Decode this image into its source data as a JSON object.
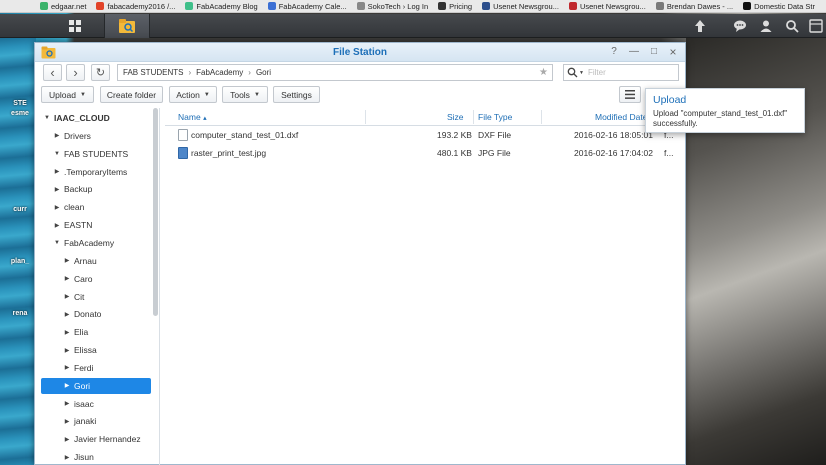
{
  "bookmarks": [
    {
      "label": "edgaar.net",
      "color": "#3bb36b"
    },
    {
      "label": "fabacademy2016 /...",
      "color": "#e24329"
    },
    {
      "label": "FabAcademy Blog",
      "color": "#3fbf8a"
    },
    {
      "label": "FabAcademy Cale...",
      "color": "#3b6fd4"
    },
    {
      "label": "SokoTech › Log In",
      "color": "#888888"
    },
    {
      "label": "Pricing",
      "color": "#333333"
    },
    {
      "label": "Usenet Newsgrou...",
      "color": "#2b4e8c"
    },
    {
      "label": "Usenet Newsgrou...",
      "color": "#c0282d"
    },
    {
      "label": "Brendan Dawes - ...",
      "color": "#7a7a7a"
    },
    {
      "label": "Domestic Data Str",
      "color": "#111111"
    }
  ],
  "desktop": {
    "labels": [
      "STE",
      "esme",
      "curr",
      "plan_",
      "rena"
    ]
  },
  "window": {
    "title": "File Station",
    "controls": {
      "help": "?",
      "minimize": "—",
      "maximize": "□",
      "close": "×"
    }
  },
  "nav": {
    "back": "‹",
    "forward": "›",
    "refresh": "↻",
    "path": [
      "FAB STUDENTS",
      "FabAcademy",
      "Gori"
    ],
    "path_sep": "›",
    "search_placeholder": "Filter"
  },
  "toolbar": {
    "upload": "Upload",
    "create_folder": "Create folder",
    "action": "Action",
    "tools": "Tools",
    "settings": "Settings"
  },
  "tree": [
    {
      "label": "IAAC_CLOUD",
      "level": 0,
      "expanded": true,
      "bold": true
    },
    {
      "label": "Drivers",
      "level": 1,
      "expanded": false
    },
    {
      "label": "FAB STUDENTS",
      "level": 1,
      "expanded": true
    },
    {
      "label": ".TemporaryItems",
      "level": 2,
      "expanded": false
    },
    {
      "label": "Backup",
      "level": 2,
      "expanded": false
    },
    {
      "label": "clean",
      "level": 2,
      "expanded": false
    },
    {
      "label": "EASTN",
      "level": 2,
      "expanded": false
    },
    {
      "label": "FabAcademy",
      "level": 2,
      "expanded": true
    },
    {
      "label": "Arnau",
      "level": 3,
      "expanded": false
    },
    {
      "label": "Caro",
      "level": 3,
      "expanded": false
    },
    {
      "label": "Cit",
      "level": 3,
      "expanded": false
    },
    {
      "label": "Donato",
      "level": 3,
      "expanded": false
    },
    {
      "label": "Elia",
      "level": 3,
      "expanded": false
    },
    {
      "label": "Elissa",
      "level": 3,
      "expanded": false
    },
    {
      "label": "Ferdi",
      "level": 3,
      "expanded": false
    },
    {
      "label": "Gori",
      "level": 3,
      "expanded": false,
      "selected": true
    },
    {
      "label": "isaac",
      "level": 3,
      "expanded": false
    },
    {
      "label": "janaki",
      "level": 3,
      "expanded": false
    },
    {
      "label": "Javier Hernandez",
      "level": 3,
      "expanded": false
    },
    {
      "label": "Jisun",
      "level": 3,
      "expanded": false
    }
  ],
  "list": {
    "columns": {
      "name": "Name",
      "sort_indicator": "▴",
      "size": "Size",
      "type": "File Type",
      "modified": "Modified Date"
    },
    "rows": [
      {
        "name": "computer_stand_test_01.dxf",
        "size": "193.2 KB",
        "type": "DXF File",
        "modified": "2016-02-16 18:05:01",
        "extra": "f...",
        "icon": "document-icon"
      },
      {
        "name": "raster_print_test.jpg",
        "size": "480.1 KB",
        "type": "JPG File",
        "modified": "2016-02-16 17:04:02",
        "extra": "f...",
        "icon": "image-icon"
      }
    ]
  },
  "notification": {
    "title": "Upload",
    "message": "Upload \"computer_stand_test_01.dxf\" successfully."
  }
}
